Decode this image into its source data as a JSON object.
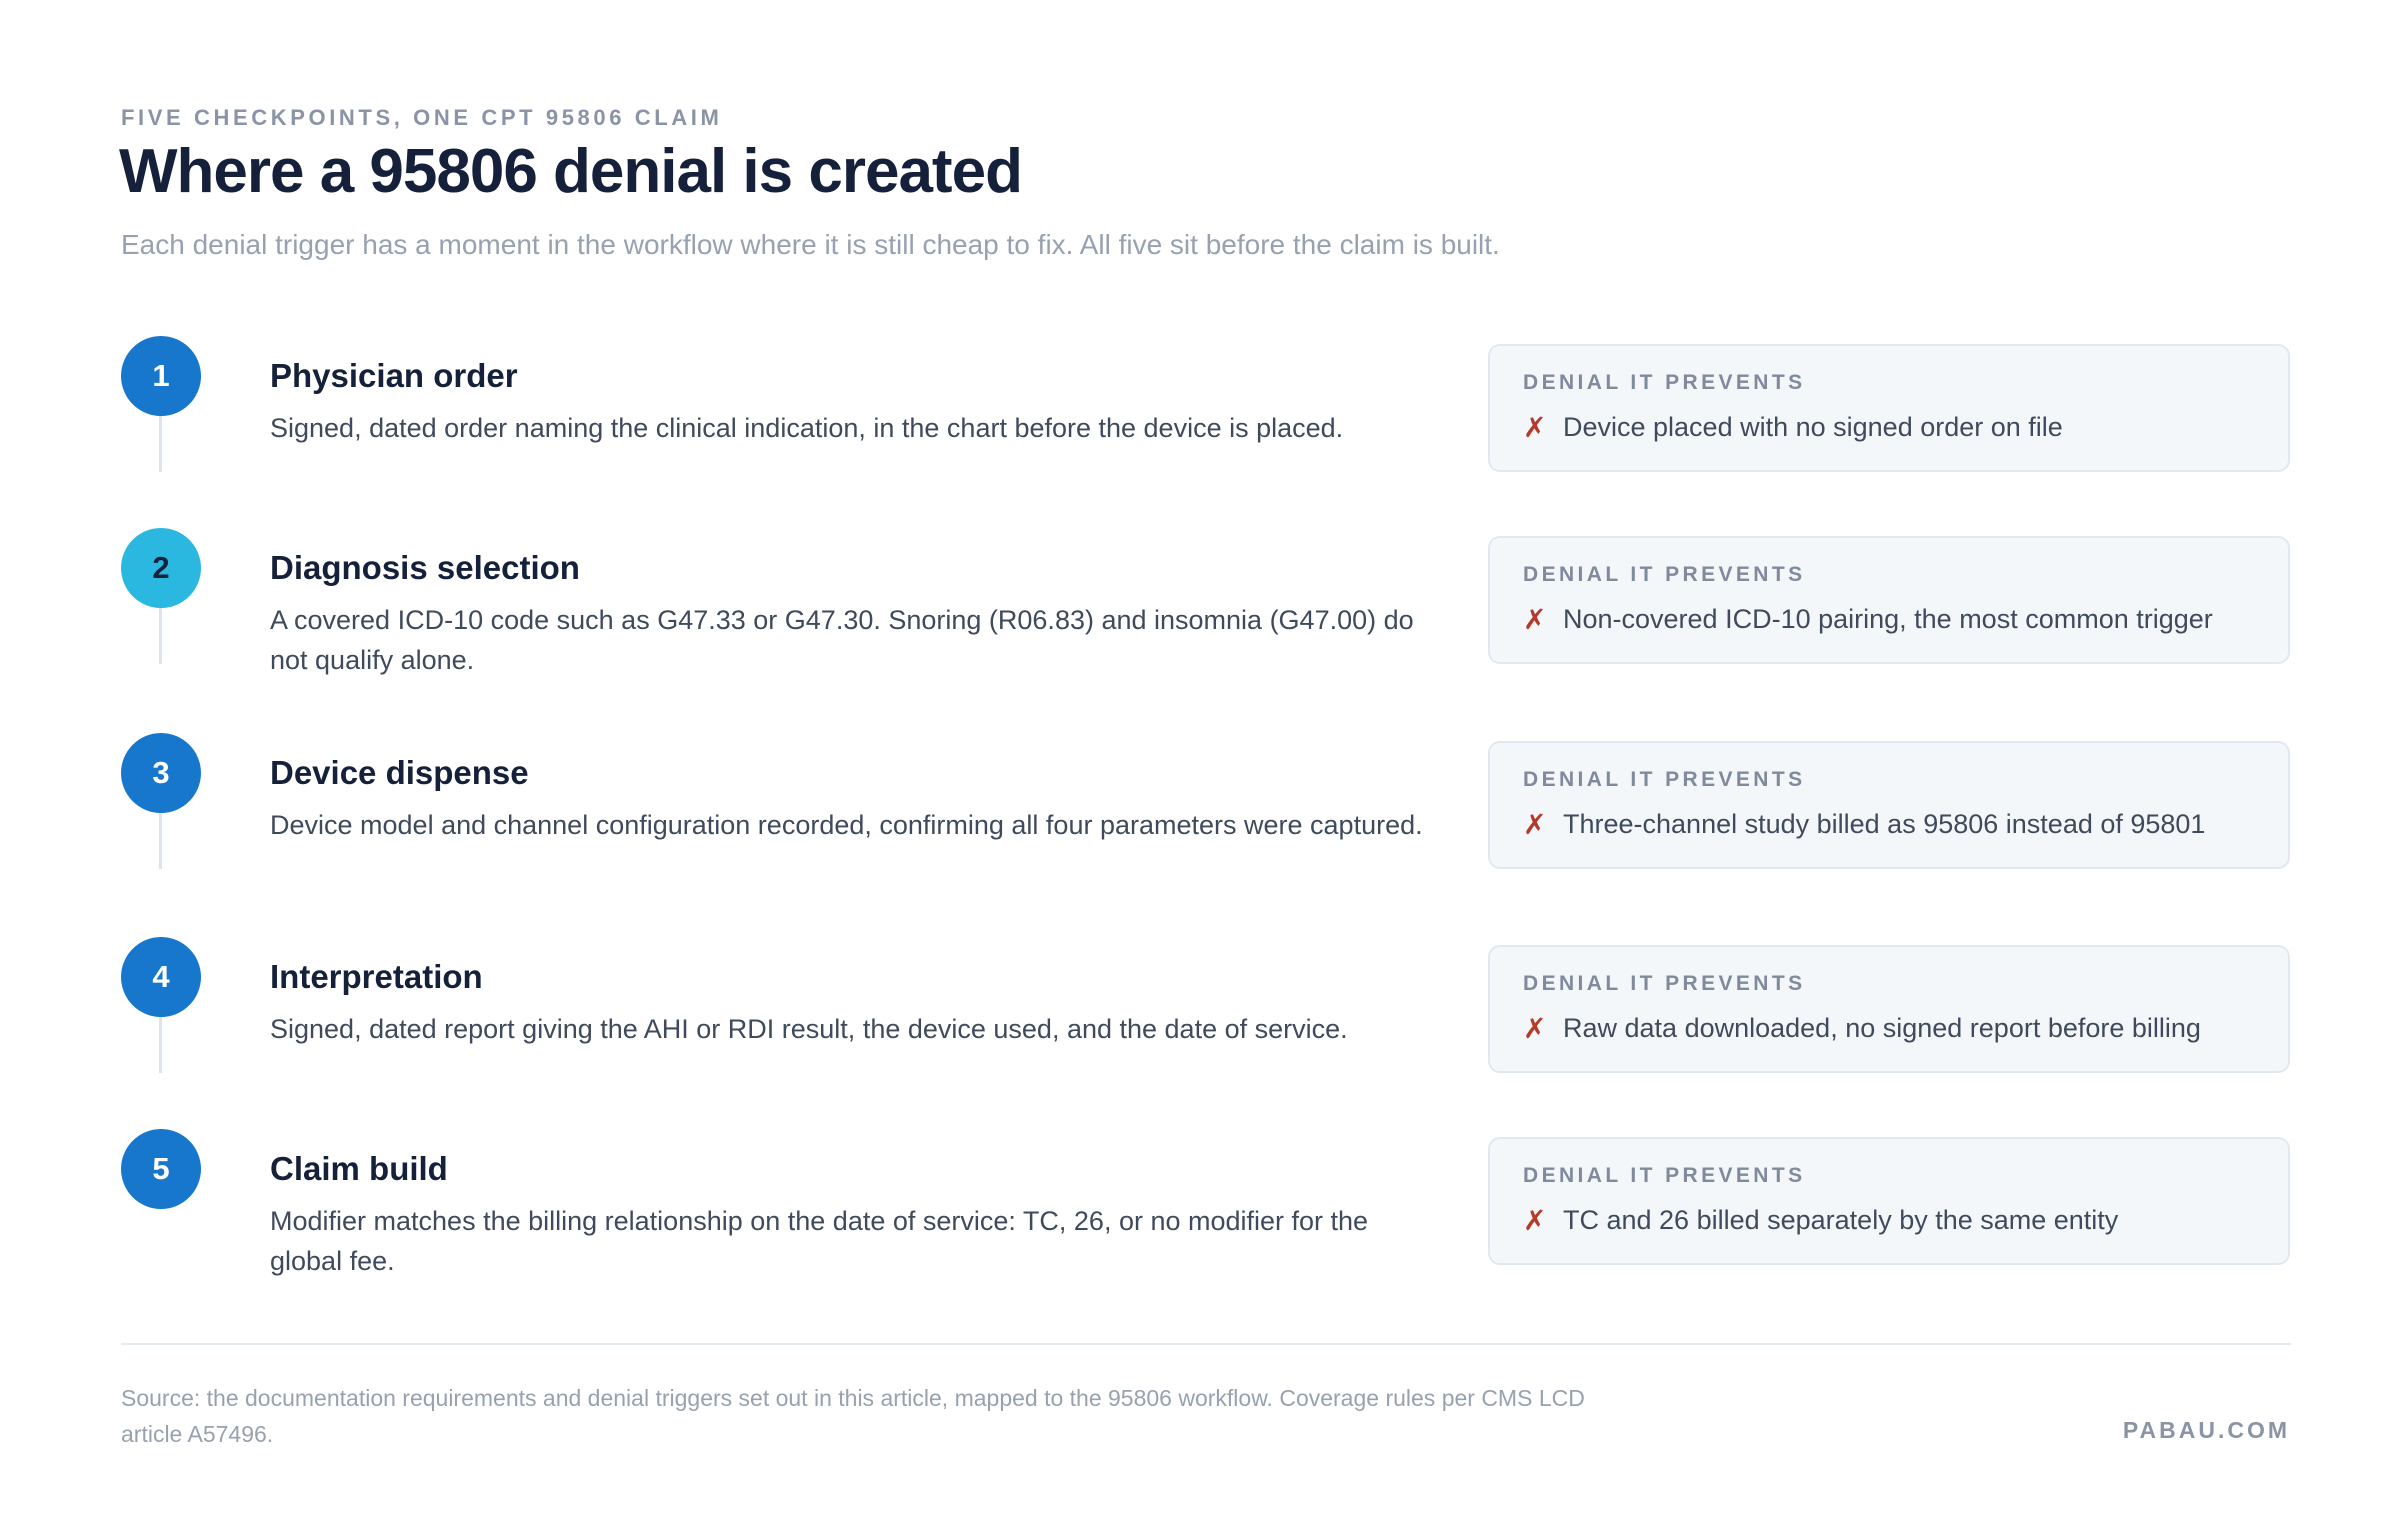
{
  "header": {
    "eyebrow": "FIVE CHECKPOINTS, ONE CPT 95806 CLAIM",
    "title": "Where a 95806 denial is created",
    "subtitle": "Each denial trigger has a moment in the workflow where it is still cheap to fix. All five sit before the claim is built."
  },
  "steps": [
    {
      "number": "1",
      "title": "Physician order",
      "description": "Signed, dated order naming the clinical indication, in the chart before the device is placed.",
      "card_label": "DENIAL IT PREVENTS",
      "card_icon": "cross-mark-icon",
      "denial": "Device placed with no signed order on file",
      "badge_color": "#1677cc"
    },
    {
      "number": "2",
      "title": "Diagnosis selection",
      "description": "A covered ICD-10 code such as G47.33 or G47.30. Snoring (R06.83) and insomnia (G47.00) do not qualify alone.",
      "card_label": "DENIAL IT PREVENTS",
      "card_icon": "cross-mark-icon",
      "denial": "Non-covered ICD-10 pairing, the most common trigger",
      "badge_color": "#2ab8e0"
    },
    {
      "number": "3",
      "title": "Device dispense",
      "description": "Device model and channel configuration recorded, confirming all four parameters were captured.",
      "card_label": "DENIAL IT PREVENTS",
      "card_icon": "cross-mark-icon",
      "denial": "Three-channel study billed as 95806 instead of 95801",
      "badge_color": "#1677cc"
    },
    {
      "number": "4",
      "title": "Interpretation",
      "description": "Signed, dated report giving the AHI or RDI result, the device used, and the date of service.",
      "card_label": "DENIAL IT PREVENTS",
      "card_icon": "cross-mark-icon",
      "denial": "Raw data downloaded, no signed report before billing",
      "badge_color": "#1677cc"
    },
    {
      "number": "5",
      "title": "Claim build",
      "description": "Modifier matches the billing relationship on the date of service: TC, 26, or no modifier for the global fee.",
      "card_label": "DENIAL IT PREVENTS",
      "card_icon": "cross-mark-icon",
      "denial": "TC and 26 billed separately by the same entity",
      "badge_color": "#1677cc"
    }
  ],
  "footer": {
    "source": "Source: the documentation requirements and denial triggers set out in this article, mapped to the 95806 workflow. Coverage rules per CMS LCD article A57496.",
    "brand": "PABAU.COM"
  },
  "colors": {
    "accent_blue": "#1677cc",
    "accent_cyan": "#2ab8e0",
    "cross_red": "#b53a2a",
    "card_bg": "#f4f7fa"
  }
}
